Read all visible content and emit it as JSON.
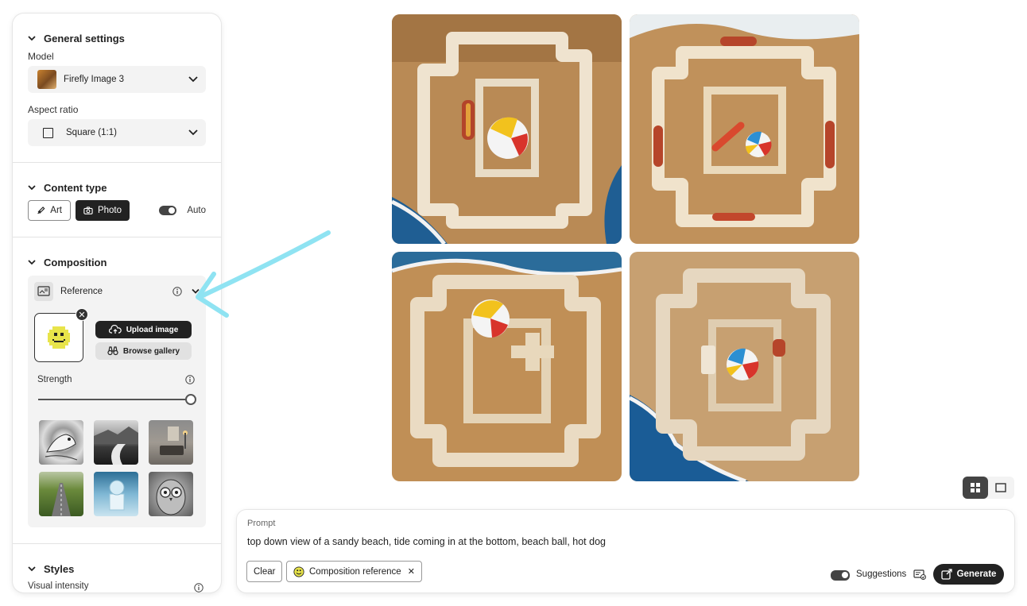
{
  "general": {
    "title": "General settings",
    "model_label": "Model",
    "model_value": "Firefly Image 3",
    "aspect_label": "Aspect ratio",
    "aspect_value": "Square (1:1)"
  },
  "content_type": {
    "title": "Content type",
    "art_label": "Art",
    "photo_label": "Photo",
    "auto_label": "Auto",
    "selected": "Photo"
  },
  "composition": {
    "title": "Composition",
    "reference_label": "Reference",
    "upload_label": "Upload image",
    "browse_label": "Browse gallery",
    "strength_label": "Strength",
    "strength_value": 1.0
  },
  "styles": {
    "title": "Styles",
    "visual_intensity_label": "Visual intensity"
  },
  "view_toggle": {
    "selected": "grid"
  },
  "prompt": {
    "label": "Prompt",
    "text": "top down view of a sandy beach, tide coming in at the bottom, beach ball, hot dog",
    "clear_label": "Clear",
    "chip_label": "Composition reference",
    "suggestions_label": "Suggestions",
    "generate_label": "Generate"
  },
  "colors": {
    "accent_dark": "#222222",
    "annotation_arrow": "#8fe3f2",
    "sand": "#c99a5c",
    "ocean": "#1f6fa5"
  }
}
